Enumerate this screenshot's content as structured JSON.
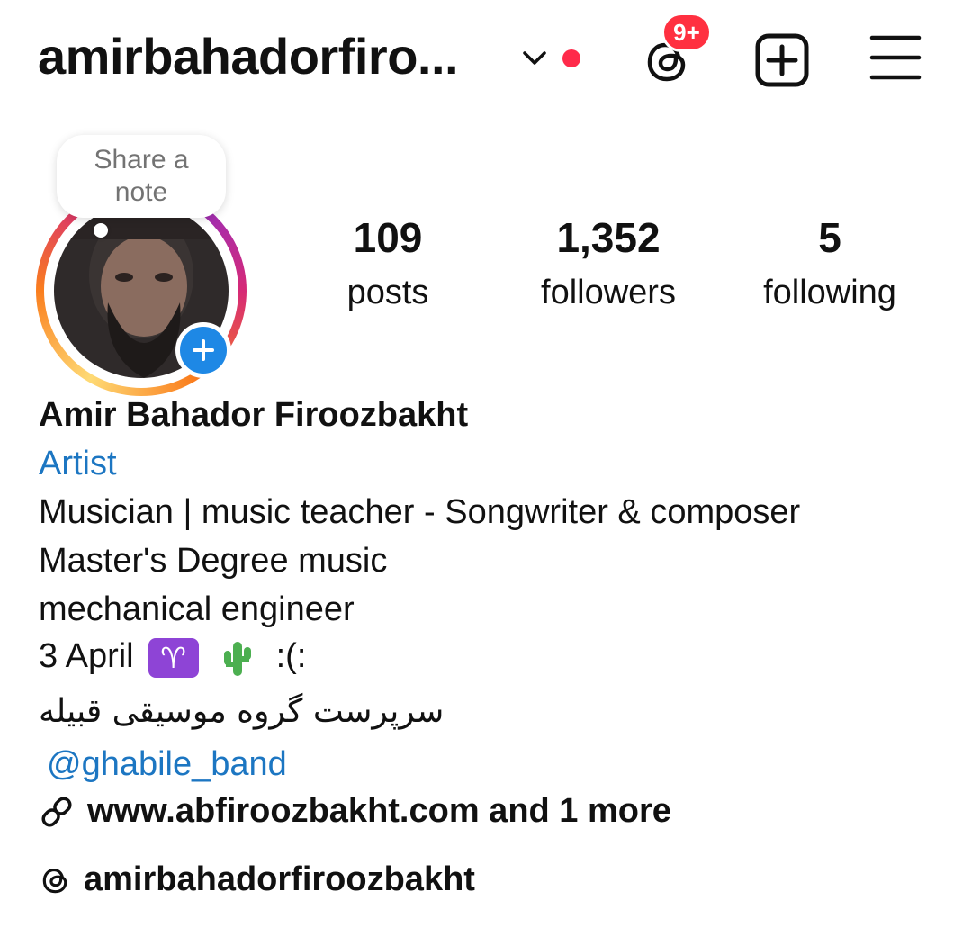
{
  "header": {
    "username": "amirbahadorfiro...",
    "threads_badge": "9+",
    "icons": {
      "chevron": "chevron-down-icon",
      "dot": "notification-dot",
      "threads": "threads-icon",
      "create": "plus-square-icon",
      "menu": "hamburger-menu-icon"
    }
  },
  "note": {
    "text_line1": "Share a",
    "text_line2": "note"
  },
  "stats": [
    {
      "value": "109",
      "label": "posts"
    },
    {
      "value": "1,352",
      "label": "followers"
    },
    {
      "value": "5",
      "label": "following"
    }
  ],
  "bio": {
    "name": "Amir Bahador Firoozbakht",
    "category": "Artist",
    "lines": [
      "Musician | music teacher - Songwriter & composer",
      "Master's Degree music",
      "mechanical engineer"
    ],
    "birthday_text": "3 April",
    "zodiac_symbol": "♈",
    "emoticon": ":(:",
    "persian_line": "سرپرست گروه موسیقی قبیله",
    "mention": "@ghabile_band",
    "link": "www.abfiroozbakht.com and 1 more",
    "threads_handle": "amirbahadorfiroozbakht"
  },
  "colors": {
    "accent_blue": "#1c76c2",
    "badge_red": "#ff3040",
    "add_blue": "#1e88e5"
  }
}
